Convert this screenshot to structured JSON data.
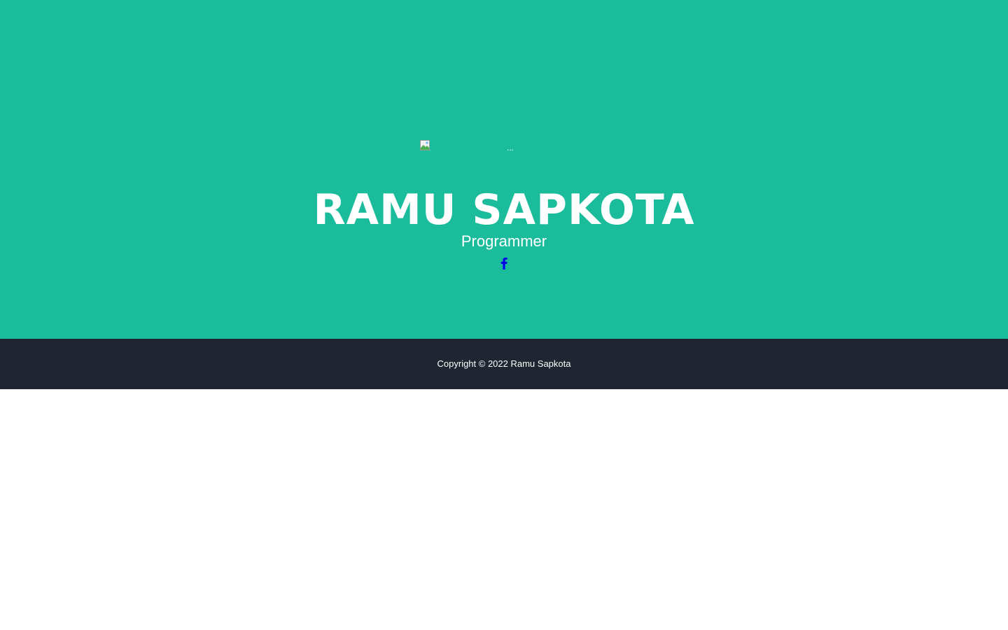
{
  "profile": {
    "image_alt": "...",
    "name": "RAMU SAPKOTA",
    "role": "Programmer"
  },
  "social": {
    "facebook_icon": "facebook-icon",
    "color": "#0000ee"
  },
  "footer": {
    "copyright": "Copyright © 2022 Ramu Sapkota"
  },
  "colors": {
    "masthead": "#1abc9c",
    "footer": "#1f2631",
    "text": "#ffffff"
  }
}
